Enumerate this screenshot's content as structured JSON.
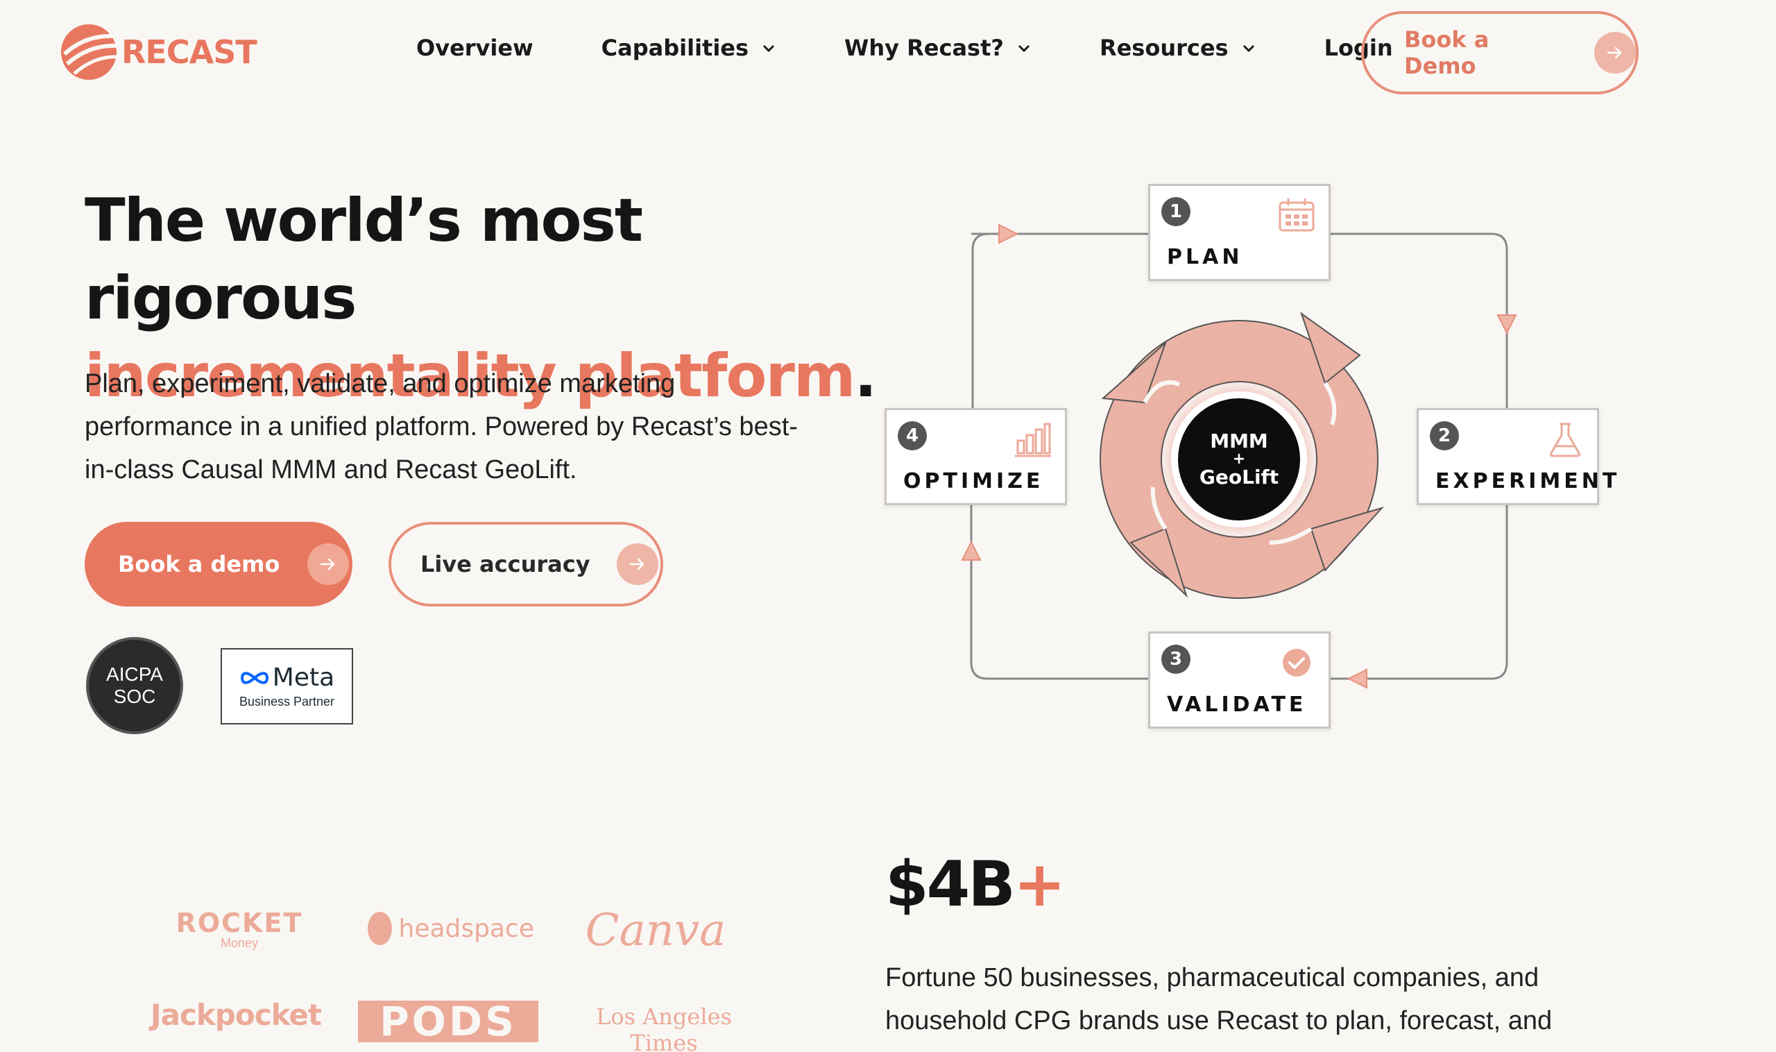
{
  "nav": {
    "logo_text": "RECAST",
    "items": [
      {
        "label": "Overview"
      },
      {
        "label": "Capabilities"
      },
      {
        "label": "Why Recast?"
      },
      {
        "label": "Resources"
      },
      {
        "label": "Login"
      }
    ],
    "cta_label": "Book a Demo"
  },
  "hero": {
    "title_line1": "The world’s most rigorous",
    "title_accent": "incrementality platform",
    "title_period": ".",
    "subtitle": "Plan, experiment, validate, and optimize marketing performance in a unified platform. Powered by Recast’s best-in-class Causal MMM and Recast GeoLift.",
    "primary_button": "Book a demo",
    "secondary_button": "Live accuracy",
    "badge_aicpa_line1": "AICPA",
    "badge_aicpa_line2": "SOC",
    "badge_meta_word": "Meta",
    "badge_meta_sub": "Business Partner"
  },
  "diagram": {
    "steps": [
      {
        "number": "1",
        "label": "PLAN",
        "icon": "calendar-icon"
      },
      {
        "number": "2",
        "label": "EXPERIMENT",
        "icon": "flask-icon"
      },
      {
        "number": "3",
        "label": "VALIDATE",
        "icon": "check-circle-icon"
      },
      {
        "number": "4",
        "label": "OPTIMIZE",
        "icon": "bar-chart-icon"
      }
    ],
    "center_line1": "MMM",
    "center_line2": "+",
    "center_line3": "GeoLift"
  },
  "customers": {
    "logos": [
      {
        "name": "ROCKET",
        "sub": "Money"
      },
      {
        "name": "headspace"
      },
      {
        "name": "Canva"
      },
      {
        "name": "Jackpocket"
      },
      {
        "name": "PODS"
      },
      {
        "name": "Los Angeles Times"
      }
    ]
  },
  "stats": {
    "number": "$4B",
    "plus": "+",
    "text": "Fortune 50 businesses, pharmaceutical companies, and household CPG brands use Recast to plan, forecast, and"
  },
  "colors": {
    "accent": "#e8775f",
    "accent_light": "#efb5a6",
    "background": "#f9f7f4",
    "text": "#151515"
  }
}
